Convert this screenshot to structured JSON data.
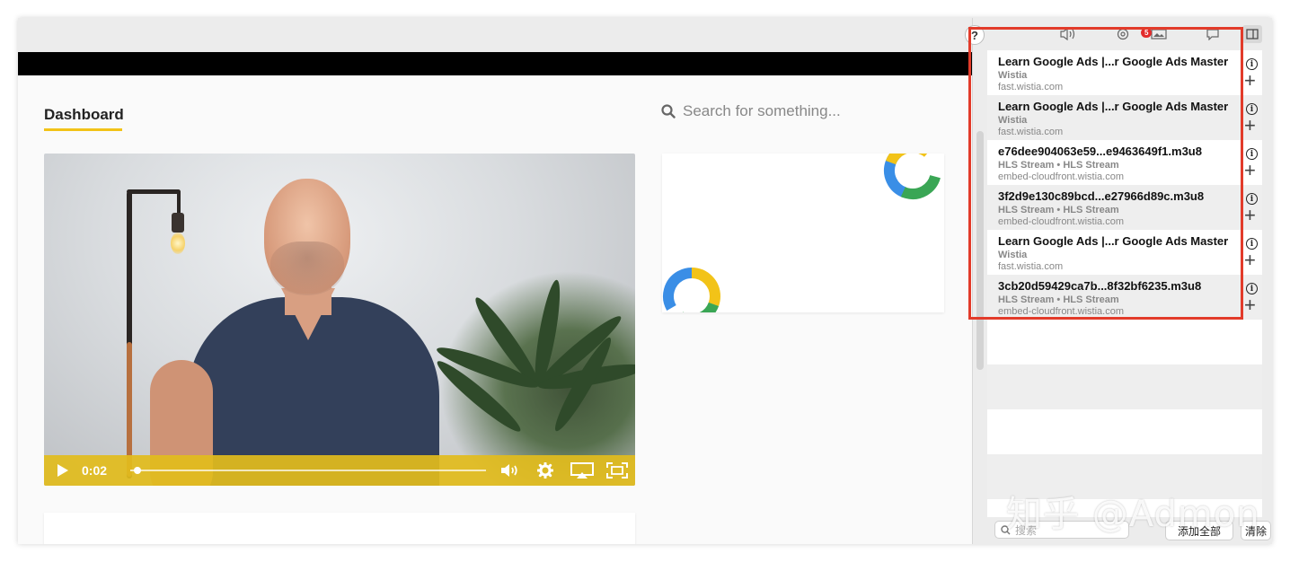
{
  "page": {
    "title": "Dashboard",
    "search_placeholder": "Search for something..."
  },
  "video": {
    "time": "0:02",
    "progress": 0.02
  },
  "toolbar": {
    "help_label": "?",
    "badge_count": "5",
    "icons": [
      "volume-icon",
      "gear-icon",
      "media-icon",
      "chat-icon",
      "sidebar-icon"
    ]
  },
  "media_list": {
    "items": [
      {
        "title": "Learn Google Ads |...r Google Ads Master",
        "subtitle": "Wistia",
        "domain": "fast.wistia.com"
      },
      {
        "title": "Learn Google Ads |...r Google Ads Master",
        "subtitle": "Wistia",
        "domain": "fast.wistia.com"
      },
      {
        "title": "e76dee904063e59...e9463649f1.m3u8",
        "subtitle": "HLS Stream • HLS Stream",
        "domain": "embed-cloudfront.wistia.com"
      },
      {
        "title": "3f2d9e130c89bcd...e27966d89c.m3u8",
        "subtitle": "HLS Stream • HLS Stream",
        "domain": "embed-cloudfront.wistia.com"
      },
      {
        "title": "Learn Google Ads |...r Google Ads Master",
        "subtitle": "Wistia",
        "domain": "fast.wistia.com"
      },
      {
        "title": "3cb20d59429ca7b...8f32bf6235.m3u8",
        "subtitle": "HLS Stream • HLS Stream",
        "domain": "embed-cloudfront.wistia.com"
      }
    ]
  },
  "bottom": {
    "search_placeholder": "搜索",
    "add_all_label": "添加全部",
    "clear_label": "清除"
  },
  "watermark": "知乎 @Admon",
  "colors": {
    "accent": "#f2c318",
    "highlight": "#e23b2a",
    "badge": "#e32b2b"
  }
}
